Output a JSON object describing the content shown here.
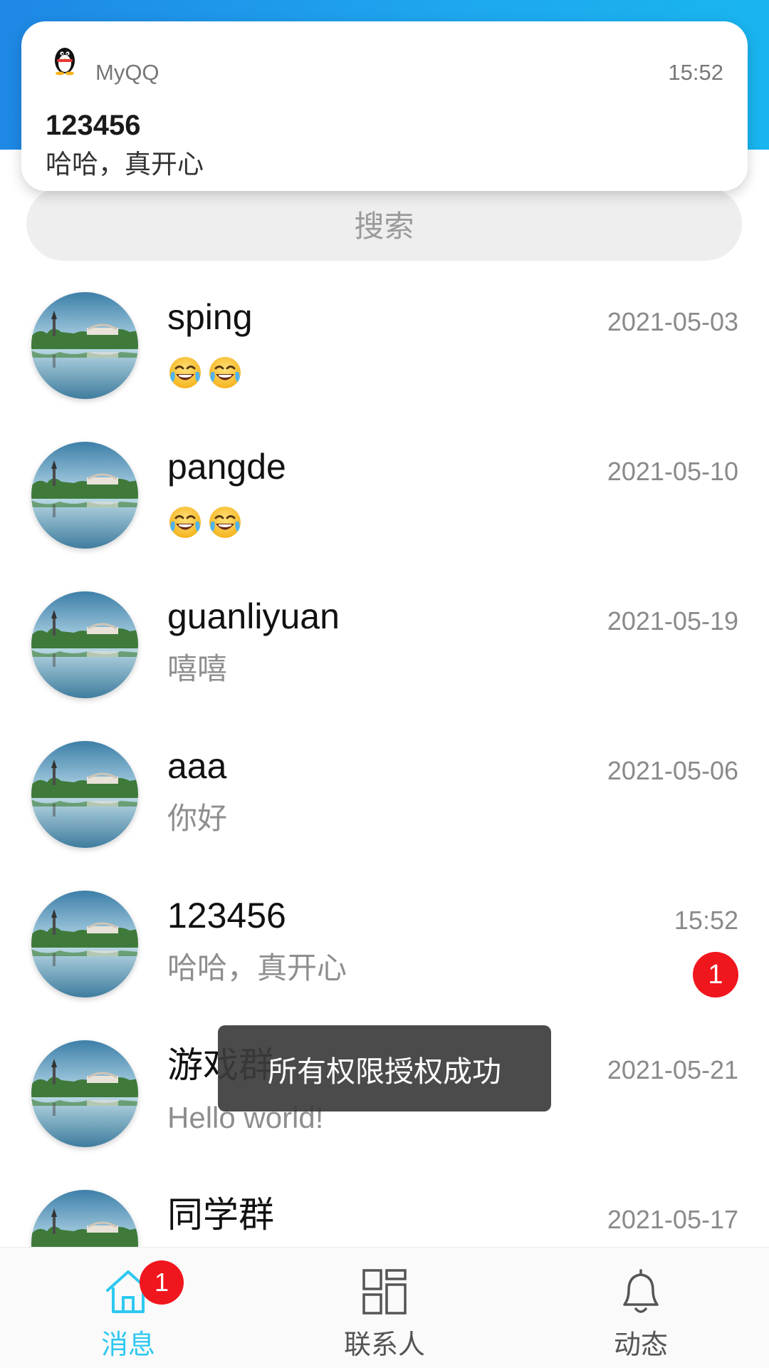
{
  "notification": {
    "app_name": "MyQQ",
    "time": "15:52",
    "title": "123456",
    "text": "哈哈，真开心",
    "icon": "penguin-icon"
  },
  "search": {
    "placeholder": "搜索"
  },
  "chats": [
    {
      "name": "sping",
      "time": "2021-05-03",
      "message": "😂😂",
      "message_is_emoji": true
    },
    {
      "name": "pangde",
      "time": "2021-05-10",
      "message": "😂😂",
      "message_is_emoji": true
    },
    {
      "name": "guanliyuan",
      "time": "2021-05-19",
      "message": "嘻嘻"
    },
    {
      "name": "aaa",
      "time": "2021-05-06",
      "message": "你好"
    },
    {
      "name": "123456",
      "time": "15:52",
      "message": "哈哈，真开心",
      "unread": "1"
    },
    {
      "name": "游戏群",
      "time": "2021-05-21",
      "message": "Hello world!"
    },
    {
      "name": "同学群",
      "time": "2021-05-17",
      "message": ""
    }
  ],
  "toast": {
    "text": "所有权限授权成功"
  },
  "bottom_nav": {
    "items": [
      {
        "label": "消息",
        "icon": "home-icon",
        "badge": "1",
        "active": true
      },
      {
        "label": "联系人",
        "icon": "grid-icon"
      },
      {
        "label": "动态",
        "icon": "bell-icon"
      }
    ]
  },
  "colors": {
    "header_gradient_start": "#1e88e5",
    "header_gradient_end": "#19b5f0",
    "accent_active": "#2ec8f0",
    "badge_red": "#f0161d",
    "toast_bg": "#3c3c3c"
  }
}
